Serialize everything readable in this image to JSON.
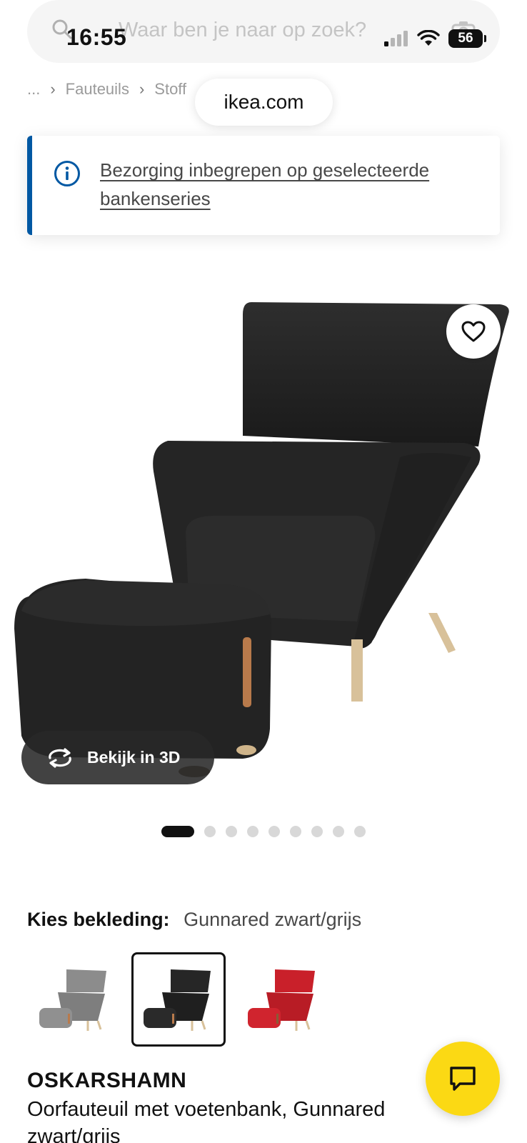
{
  "status_bar": {
    "time": "16:55",
    "battery": "56"
  },
  "search": {
    "placeholder": "Waar ben je naar op zoek?"
  },
  "breadcrumb": {
    "items": [
      "...",
      "Fauteuils",
      "Stoff"
    ]
  },
  "browser": {
    "url": "ikea.com"
  },
  "banner": {
    "text": "Bezorging inbegrepen op geselecteerde bankenseries"
  },
  "product_image": {
    "view3d_label": "Bekijk in 3D",
    "dot_count": 9,
    "active_dot": 0
  },
  "upholstery": {
    "label": "Kies bekleding:",
    "value": "Gunnared zwart/grijs",
    "options": [
      {
        "color": "#8c8c8c",
        "selected": false
      },
      {
        "color": "#262626",
        "selected": true
      },
      {
        "color": "#c9202a",
        "selected": false
      }
    ]
  },
  "product": {
    "name": "OSKARSHAMN",
    "description": "Oorfauteuil met voetenbank, Gunnared zwart/grijs"
  },
  "colors": {
    "accent_blue": "#0058a3",
    "chat_yellow": "#fbd914"
  }
}
